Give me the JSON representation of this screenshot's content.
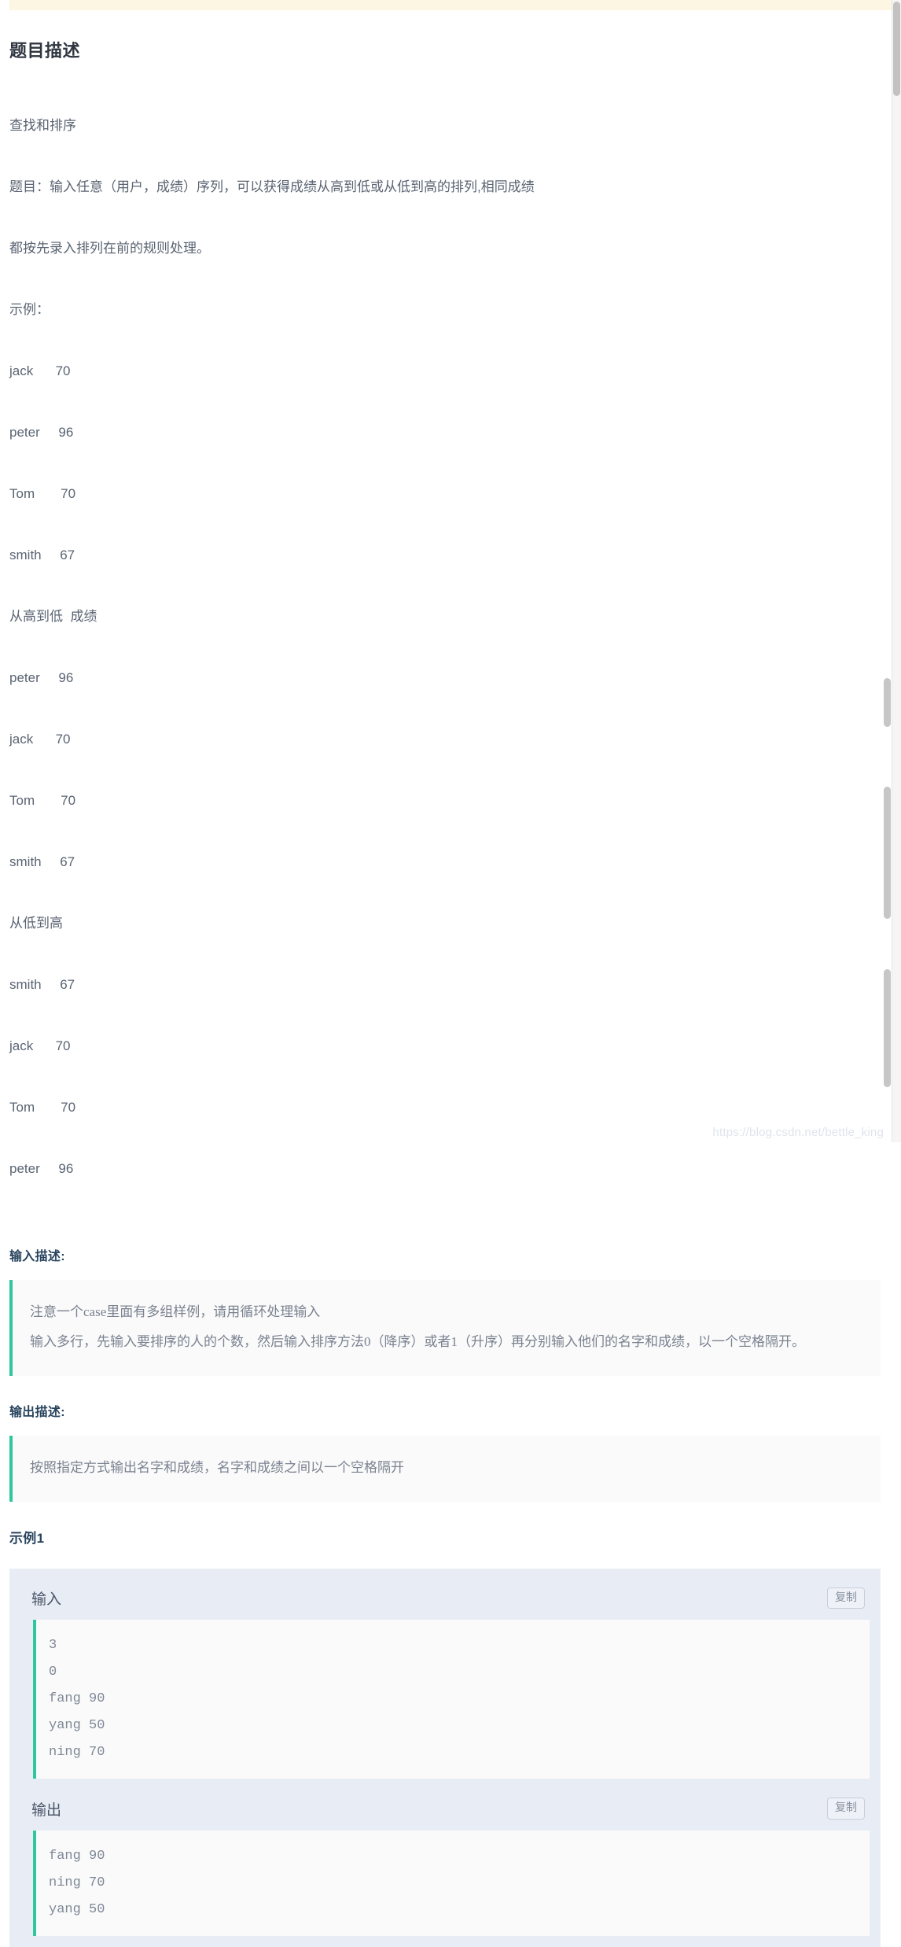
{
  "colors": {
    "top_bar": "#fdf6e3",
    "accent_border": "#30c79e",
    "quote_bg": "#fafafa",
    "example_card_bg": "#e8edf5",
    "heading": "#28445e",
    "body_text": "#5a6472"
  },
  "sections": {
    "problem": {
      "heading": "题目描述",
      "lines": [
        "查找和排序",
        "题目：输入任意（用户，成绩）序列，可以获得成绩从高到低或从低到高的排列,相同成绩",
        "都按先录入排列在前的规则处理。",
        "示例：",
        "jack      70",
        "peter     96",
        "Tom       70",
        "smith     67",
        "从高到低  成绩",
        "peter     96",
        "jack      70",
        "Tom       70",
        "smith     67",
        "从低到高",
        "smith     67",
        "jack      70",
        "Tom       70",
        "peter     96"
      ]
    },
    "input_desc": {
      "heading": "输入描述:",
      "paragraphs": [
        "注意一个case里面有多组样例，请用循环处理输入",
        "输入多行，先输入要排序的人的个数，然后输入排序方法0（降序）或者1（升序）再分别输入他们的名字和成绩，以一个空格隔开。"
      ]
    },
    "output_desc": {
      "heading": "输出描述:",
      "paragraphs": [
        "按照指定方式输出名字和成绩，名字和成绩之间以一个空格隔开"
      ]
    },
    "example": {
      "heading": "示例1",
      "input": {
        "label": "输入",
        "copy_label": "复制",
        "lines": [
          "3",
          "0",
          "fang 90",
          "yang 50",
          "ning 70"
        ]
      },
      "output": {
        "label": "输出",
        "copy_label": "复制",
        "lines": [
          "fang 90",
          "ning 70",
          "yang 50"
        ]
      }
    }
  },
  "watermark": "https://blog.csdn.net/bettle_king"
}
